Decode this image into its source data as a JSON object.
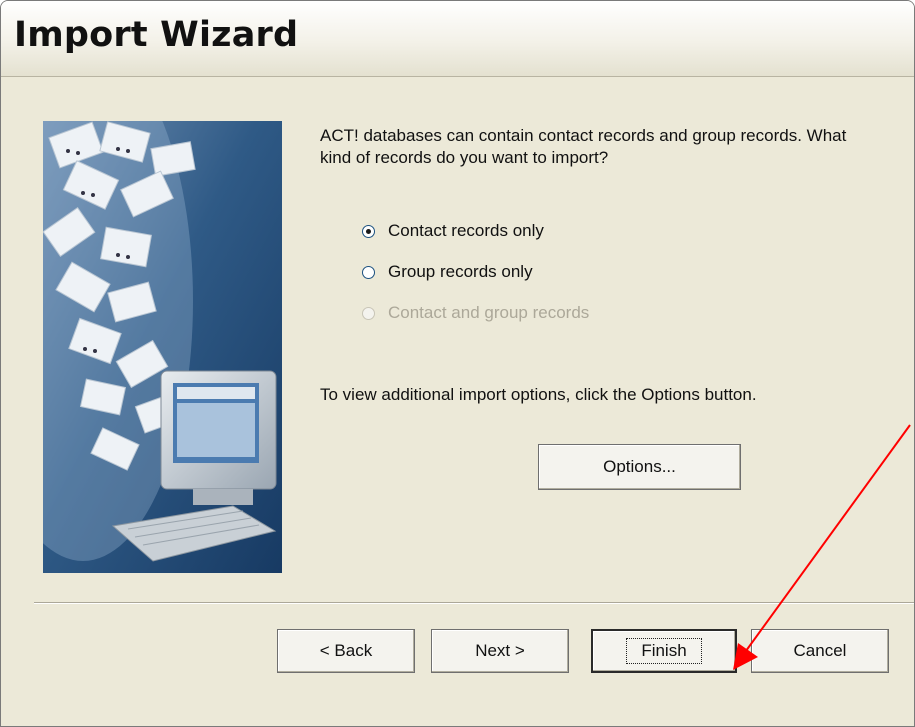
{
  "window": {
    "title": "Import Wizard"
  },
  "content": {
    "intro": "ACT! databases can contain contact records and group records.  What kind of records do you want to import?",
    "hint": "To view additional import options, click the Options button."
  },
  "radios": [
    {
      "label": "Contact records only",
      "checked": true,
      "enabled": true
    },
    {
      "label": "Group records only",
      "checked": false,
      "enabled": true
    },
    {
      "label": "Contact and group records",
      "checked": false,
      "enabled": false
    }
  ],
  "buttons": {
    "options": "Options...",
    "back": "< Back",
    "next": "Next >",
    "finish": "Finish",
    "cancel": "Cancel"
  },
  "annotation": {
    "color": "#ff0000"
  }
}
